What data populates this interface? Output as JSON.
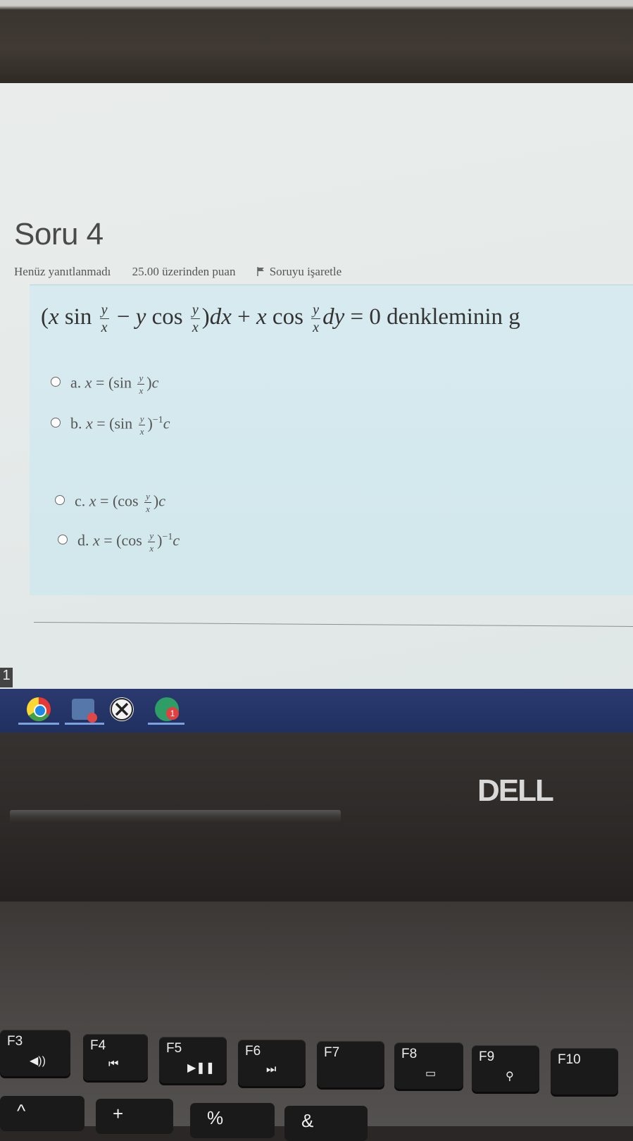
{
  "question": {
    "title": "Soru 4",
    "status": "Henüz yanıtlanmadı",
    "points": "25.00 üzerinden puan",
    "flag_label": "Soruyu işaretle",
    "equation_tail": "= 0 denkleminin g",
    "options": [
      {
        "letter": "a.",
        "func": "sin",
        "power": ""
      },
      {
        "letter": "b.",
        "func": "sin",
        "power": "−1"
      },
      {
        "letter": "c.",
        "func": "cos",
        "power": ""
      },
      {
        "letter": "d.",
        "func": "cos",
        "power": "−1"
      }
    ]
  },
  "taskbar": {
    "number": "1",
    "badge_count": "1"
  },
  "laptop": {
    "brand": "DELL"
  },
  "keys": {
    "f3": "F3",
    "f4": "F4",
    "f5": "F5",
    "f6": "F6",
    "f7": "F7",
    "f8": "F8",
    "f9": "F9",
    "f10": "F10",
    "row2": [
      "^",
      "+",
      "%",
      "&"
    ]
  },
  "colors": {
    "question_box": "#d2e8ec",
    "taskbar": "#203060"
  }
}
